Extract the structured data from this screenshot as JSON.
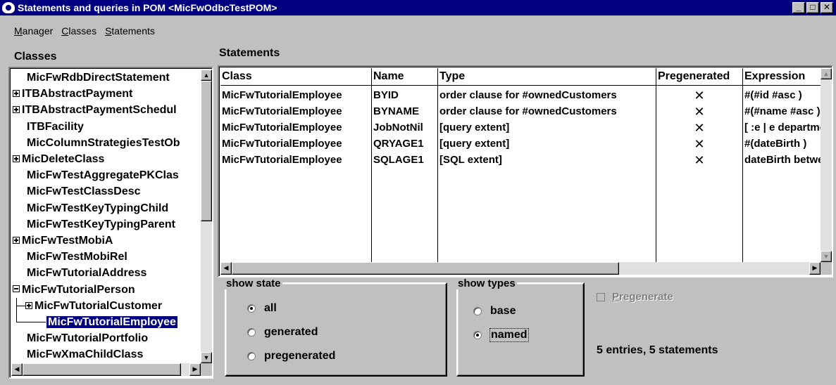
{
  "window": {
    "title": "Statements and queries in POM <MicFwOdbcTestPOM>"
  },
  "menu": [
    "Manager",
    "Classes",
    "Statements"
  ],
  "classes_panel": {
    "label": "Classes",
    "items": [
      {
        "label": "MicFwRdbDirectStatement",
        "expander": "none"
      },
      {
        "label": "ITBAbstractPayment",
        "expander": "plus"
      },
      {
        "label": "ITBAbstractPaymentSchedul",
        "expander": "plus"
      },
      {
        "label": "ITBFacility",
        "expander": "none"
      },
      {
        "label": "MicColumnStrategiesTestOb",
        "expander": "none"
      },
      {
        "label": "MicDeleteClass",
        "expander": "plus"
      },
      {
        "label": "MicFwTestAggregatePKClas",
        "expander": "none"
      },
      {
        "label": "MicFwTestClassDesc",
        "expander": "none"
      },
      {
        "label": "MicFwTestKeyTypingChild",
        "expander": "none"
      },
      {
        "label": "MicFwTestKeyTypingParent",
        "expander": "none"
      },
      {
        "label": "MicFwTestMobiA",
        "expander": "plus"
      },
      {
        "label": "MicFwTestMobiRel",
        "expander": "none"
      },
      {
        "label": "MicFwTutorialAddress",
        "expander": "none"
      },
      {
        "label": "MicFwTutorialPerson",
        "expander": "minus"
      },
      {
        "label": "MicFwTutorialCustomer",
        "expander": "plus",
        "child": true
      },
      {
        "label": "MicFwTutorialEmployee",
        "expander": "none",
        "child": true,
        "selected": true
      },
      {
        "label": "MicFwTutorialPortfolio",
        "expander": "none"
      },
      {
        "label": "MicFwXmaChildClass",
        "expander": "none"
      }
    ]
  },
  "statements_panel": {
    "label": "Statements",
    "columns": [
      "Class",
      "Name",
      "Type",
      "Pregenerated",
      "Expression"
    ],
    "rows": [
      [
        "MicFwTutorialEmployee",
        "BYID",
        "order clause for #ownedCustomers",
        "✕",
        "#(#id #asc )"
      ],
      [
        "MicFwTutorialEmployee",
        "BYNAME",
        "order clause for #ownedCustomers",
        "✕",
        "#(#name #asc )"
      ],
      [
        "MicFwTutorialEmployee",
        "JobNotNil",
        "[query extent]",
        "✕",
        "[ :e | e department"
      ],
      [
        "MicFwTutorialEmployee",
        "QRYAGE1",
        "[query extent]",
        "✕",
        "#(dateBirth )"
      ],
      [
        "MicFwTutorialEmployee",
        "SQLAGE1",
        "[SQL extent]",
        "✕",
        "dateBirth between"
      ]
    ]
  },
  "show_state": {
    "label": "show state",
    "options": [
      "all",
      "generated",
      "pregenerated"
    ],
    "selected": "all"
  },
  "show_types": {
    "label": "show types",
    "options": [
      "base",
      "named"
    ],
    "selected": "named"
  },
  "pregenerate": {
    "label": "Pregenerate",
    "checked": false,
    "enabled": false
  },
  "status": "5 entries, 5 statements"
}
